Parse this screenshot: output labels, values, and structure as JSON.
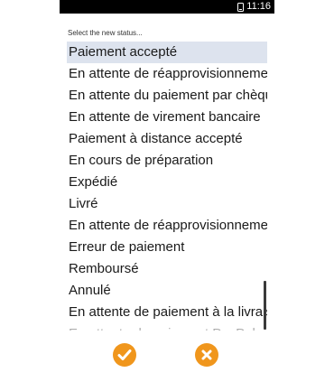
{
  "statusbar": {
    "time": "11:16"
  },
  "dialog": {
    "prompt": "Select the new status...",
    "items": [
      "Paiement accepté",
      "En attente de réapprovisionnement",
      "En attente du paiement par chèque",
      "En attente de virement bancaire",
      "Paiement à distance accepté",
      "En cours de préparation",
      "Expédié",
      "Livré",
      "En attente de réapprovisionnement",
      "Erreur de paiement",
      "Remboursé",
      "Annulé",
      "En attente de paiement à la livraison",
      "En attente de paiement PayPal"
    ],
    "selected_index": 0
  },
  "colors": {
    "accent": "#f0961c",
    "selection": "#dde3ee"
  },
  "icons": {
    "confirm": "checkmark-icon",
    "cancel": "cross-icon"
  }
}
